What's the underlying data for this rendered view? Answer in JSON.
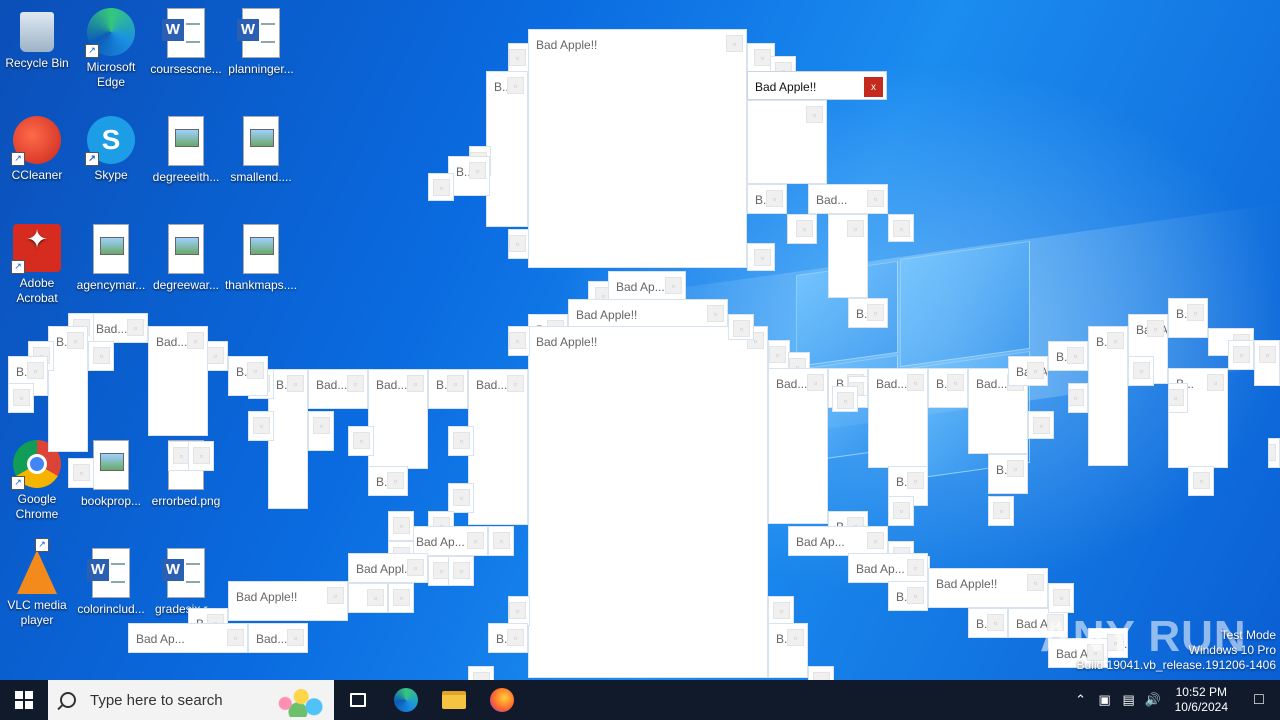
{
  "desktop": {
    "icons": [
      {
        "label": "Recycle Bin",
        "glyph": "recycle-bin",
        "shortcut": false
      },
      {
        "label": "Microsoft Edge",
        "glyph": "edge",
        "shortcut": true
      },
      {
        "label": "coursescne...",
        "glyph": "word",
        "shortcut": false
      },
      {
        "label": "planninger...",
        "glyph": "word",
        "shortcut": false
      },
      {
        "label": "CCleaner",
        "glyph": "ccleaner",
        "shortcut": true
      },
      {
        "label": "Skype",
        "glyph": "skype",
        "shortcut": true
      },
      {
        "label": "degreeeith...",
        "glyph": "image",
        "shortcut": false
      },
      {
        "label": "smallend....",
        "glyph": "image",
        "shortcut": false
      },
      {
        "label": "Adobe Acrobat",
        "glyph": "acrobat",
        "shortcut": true
      },
      {
        "label": "agencymar...",
        "glyph": "image",
        "shortcut": false
      },
      {
        "label": "degreewar...",
        "glyph": "image",
        "shortcut": false
      },
      {
        "label": "thankmaps....",
        "glyph": "image",
        "shortcut": false
      },
      {
        "label": "Google Chrome",
        "glyph": "chrome",
        "shortcut": true
      },
      {
        "label": "bookprop...",
        "glyph": "image",
        "shortcut": false
      },
      {
        "label": "errorbed.png",
        "glyph": "image",
        "shortcut": false
      },
      {
        "label": "VLC media player",
        "glyph": "vlc",
        "shortcut": true
      },
      {
        "label": "colorinclud...",
        "glyph": "word",
        "shortcut": false
      },
      {
        "label": "gradesix.r...",
        "glyph": "word",
        "shortcut": false
      }
    ],
    "popup_titles": {
      "full": "Bad Apple!!",
      "short": "Bad...",
      "mid": "Bad Ap...",
      "mid2": "Bad Appl...",
      "tiny": "B..."
    },
    "close_glyph": "x",
    "blank_glyph": "▫"
  },
  "watermark": {
    "line1": "Test Mode",
    "line2": "Windows 10 Pro",
    "line3": "Build 19041.vb_release.191206-1406",
    "brand": "ANY RUN"
  },
  "taskbar": {
    "search_placeholder": "Type here to search",
    "apps": [
      "task-view",
      "edge",
      "file-explorer",
      "firefox"
    ],
    "tray_icons": [
      "chevron-up",
      "meet-now",
      "network",
      "volume"
    ],
    "clock_time": "10:52 PM",
    "clock_date": "10/6/2024"
  }
}
